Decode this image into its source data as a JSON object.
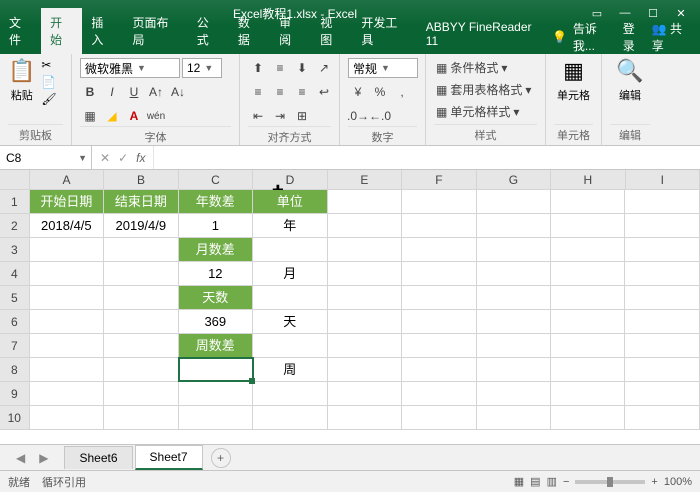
{
  "title": "Excel教程1.xlsx - Excel",
  "tabs": {
    "file": "文件",
    "home": "开始",
    "insert": "插入",
    "layout": "页面布局",
    "formulas": "公式",
    "data": "数据",
    "review": "审阅",
    "view": "视图",
    "dev": "开发工具",
    "abbyy": "ABBYY FineReader 11",
    "tell": "告诉我...",
    "login": "登录",
    "share": "共享"
  },
  "ribbon": {
    "clipboard": "剪贴板",
    "paste": "粘贴",
    "font_group": "字体",
    "font_name": "微软雅黑",
    "font_size": "12",
    "align_group": "对齐方式",
    "number_group": "数字",
    "number_format": "常规",
    "styles_group": "样式",
    "cond_format": "条件格式",
    "table_format": "套用表格格式",
    "cell_styles": "单元格样式",
    "cells_group": "单元格",
    "editing_group": "编辑"
  },
  "namebox": "C8",
  "columns": [
    "A",
    "B",
    "C",
    "D",
    "E",
    "F",
    "G",
    "H",
    "I"
  ],
  "sheet": {
    "r1": {
      "A": "开始日期",
      "B": "结束日期",
      "C": "年数差",
      "D": "单位"
    },
    "r2": {
      "A": "2018/4/5",
      "B": "2019/4/9",
      "C": "1",
      "D": "年"
    },
    "r3": {
      "C": "月数差"
    },
    "r4": {
      "C": "12",
      "D": "月"
    },
    "r5": {
      "C": "天数"
    },
    "r6": {
      "C": "369",
      "D": "天"
    },
    "r7": {
      "C": "周数差"
    },
    "r8": {
      "D": "周"
    }
  },
  "sheets": {
    "s6": "Sheet6",
    "s7": "Sheet7"
  },
  "status": {
    "left1": "就绪",
    "left2": "循环引用",
    "zoom": "100%"
  }
}
